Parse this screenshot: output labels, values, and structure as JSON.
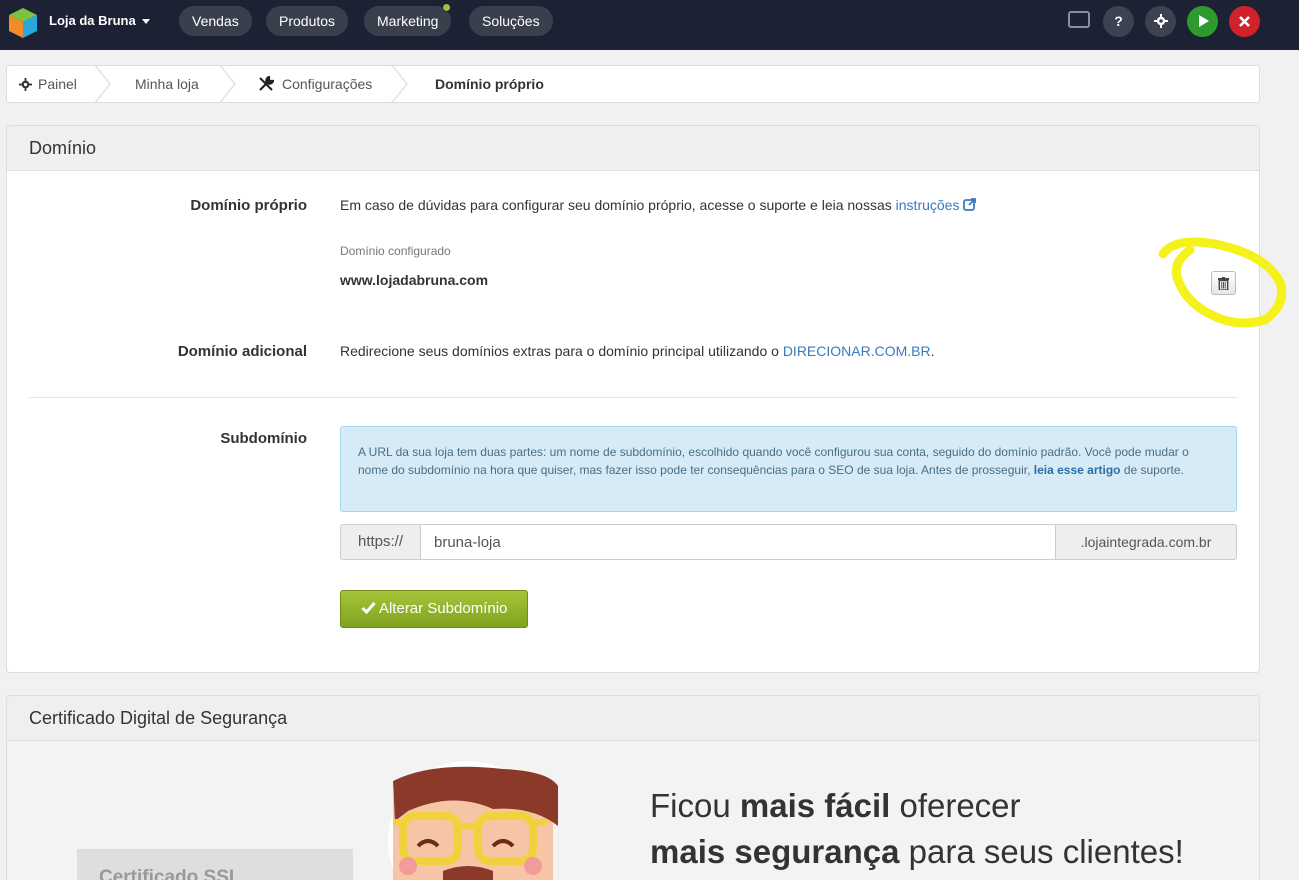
{
  "topbar": {
    "store_name": "Loja da Bruna",
    "nav": [
      "Vendas",
      "Produtos",
      "Marketing",
      "Soluções"
    ],
    "icons": [
      "screen-icon",
      "help-icon",
      "gear-icon",
      "play-icon",
      "close-icon"
    ],
    "colors": {
      "bg": "#1c2133",
      "play": "#2e9a2e",
      "close": "#d0222a",
      "notif": "#9bc53d"
    }
  },
  "breadcrumb": {
    "items": [
      "Painel",
      "Minha loja",
      "Configurações",
      "Domínio próprio"
    ]
  },
  "dominio": {
    "title": "Domínio",
    "proprio_label": "Domínio próprio",
    "proprio_text": "Em caso de dúvidas para configurar seu domínio próprio, acesse o suporte e leia nossas",
    "proprio_link": "instruções",
    "configurado_label": "Domínio configurado",
    "configurado_value": "www.lojadabruna.com",
    "adicional_label": "Domínio adicional",
    "adicional_text": "Redirecione seus domínios extras para o domínio principal utilizando o",
    "adicional_link": "DIRECIONAR.COM.BR",
    "adicional_suffix": ".",
    "subdominio_label": "Subdomínio",
    "info_text": "A URL da sua loja tem duas partes: um nome de subdomínio, escolhido quando você configurou sua conta, seguido do domínio padrão. Você pode mudar o nome do subdomínio na hora que quiser, mas fazer isso pode ter consequências para o SEO de sua loja. Antes de prosseguir,",
    "info_link": "leia esse artigo",
    "info_suffix": "de suporte.",
    "prefix": "https://",
    "subdomain_value": "bruna-loja",
    "suffix": ".lojaintegrada.com.br",
    "button_label": "Alterar Subdomínio"
  },
  "certificado": {
    "title": "Certificado Digital de Segurança",
    "ssl_tab": "Certificado SSL",
    "promo_1a": "Ficou ",
    "promo_1b": "mais fácil",
    "promo_1c": " oferecer",
    "promo_2a": "mais segurança",
    "promo_2b": " para seus clientes!"
  }
}
